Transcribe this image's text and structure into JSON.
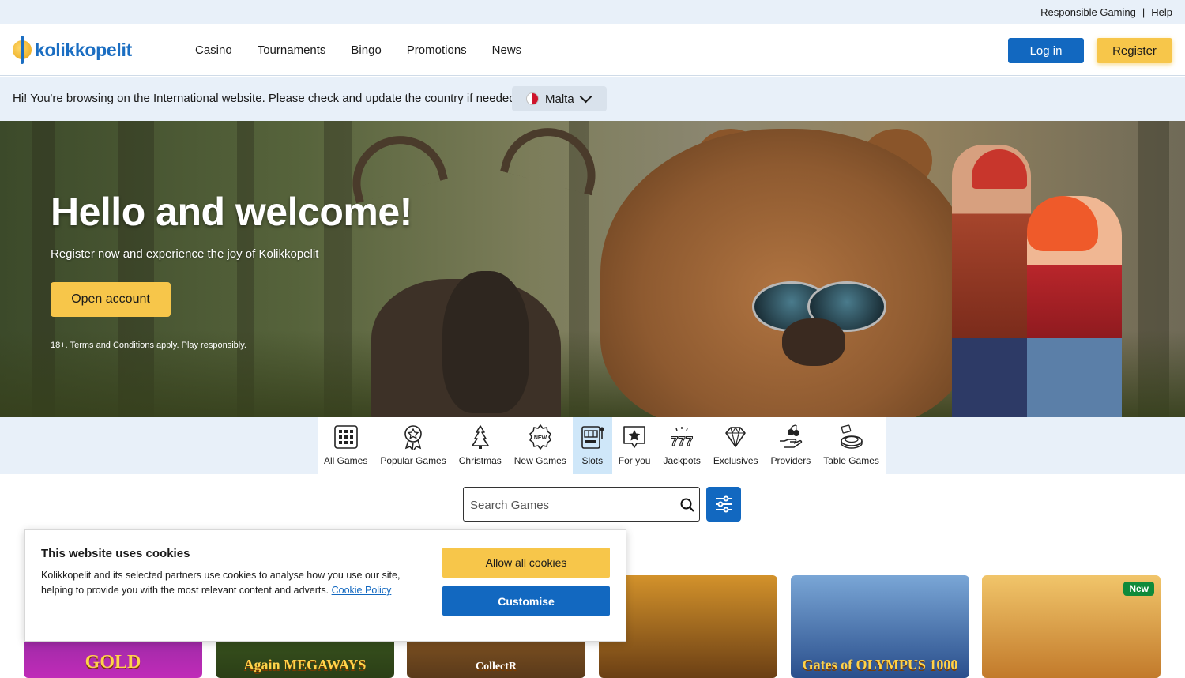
{
  "utility": {
    "responsible": "Responsible Gaming",
    "separator": "|",
    "help": "Help"
  },
  "header": {
    "logo": "kolikkopelit",
    "nav": [
      "Casino",
      "Tournaments",
      "Bingo",
      "Promotions",
      "News"
    ],
    "login": "Log in",
    "register": "Register"
  },
  "country_bar": {
    "message": "Hi! You're browsing on the International website. Please check and update the country if needed!",
    "selected_country": "Malta"
  },
  "hero": {
    "title": "Hello and welcome!",
    "subtitle": "Register now and experience the joy of Kolikkopelit",
    "cta": "Open account",
    "note": "18+. Terms and Conditions apply. Play responsibly."
  },
  "categories": {
    "items": [
      {
        "label": "All Games",
        "icon": "grid-icon"
      },
      {
        "label": "Popular Games",
        "icon": "award-icon"
      },
      {
        "label": "Christmas",
        "icon": "tree-icon"
      },
      {
        "label": "New Games",
        "icon": "new-badge-icon"
      },
      {
        "label": "Slots",
        "icon": "slot-machine-icon"
      },
      {
        "label": "For you",
        "icon": "star-bubble-icon"
      },
      {
        "label": "Jackpots",
        "icon": "sevens-icon"
      },
      {
        "label": "Exclusives",
        "icon": "diamond-icon"
      },
      {
        "label": "Providers",
        "icon": "hand-cherry-icon"
      },
      {
        "label": "Table Games",
        "icon": "roulette-icon"
      }
    ],
    "active": "Slots"
  },
  "search": {
    "placeholder": "Search Games"
  },
  "games": {
    "tiles": [
      {
        "label": "GOLD"
      },
      {
        "label": "Again MEGAWAYS"
      },
      {
        "label": "CollectR"
      },
      {
        "label": ""
      },
      {
        "label": "Gates of OLYMPUS 1000"
      },
      {
        "label": "",
        "badge": "New"
      }
    ]
  },
  "cookie": {
    "title": "This website uses cookies",
    "text": "Kolikkopelit and its selected partners use cookies to analyse how you use our site, helping to provide you with the most relevant content and adverts.",
    "policy_link": "Cookie Policy",
    "allow": "Allow all cookies",
    "customise": "Customise"
  },
  "colors": {
    "brand_blue": "#1268c0",
    "brand_yellow": "#f7c64a",
    "light_bg": "#e8f0f9",
    "active_tab": "#cfe7f9"
  }
}
